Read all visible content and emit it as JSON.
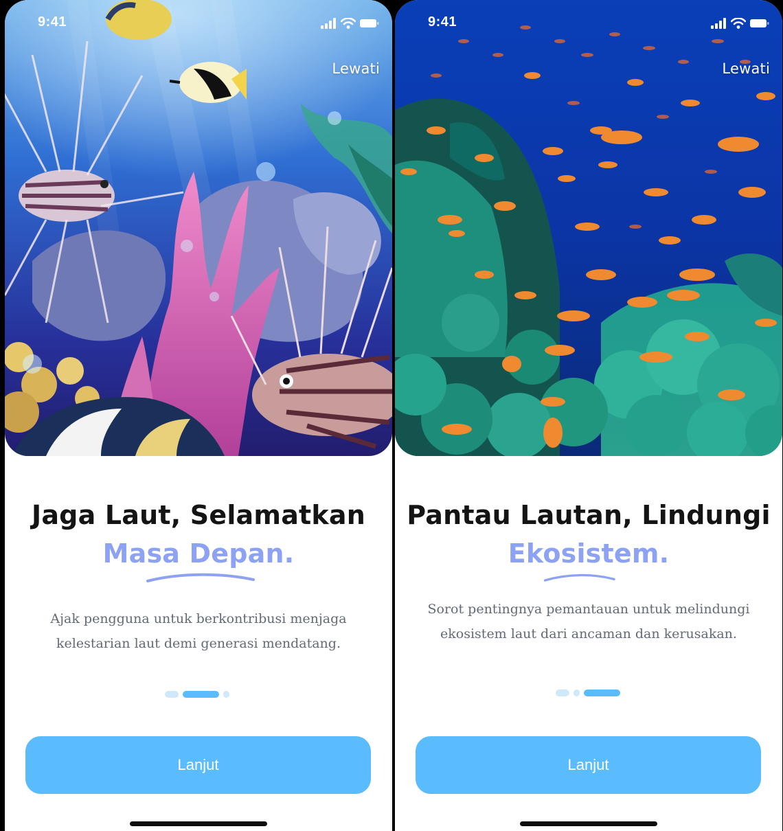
{
  "screens": [
    {
      "status_time": "9:41",
      "skip_label": "Lewati",
      "hero_image": "illustrated-reef-with-lionfish",
      "title_line1": "Jaga Laut, Selamatkan",
      "title_line2": "Masa Depan.",
      "description": "Ajak pengguna untuk berkontribusi menjaga kelestarian laut demi generasi mendatang.",
      "active_page_index": 1,
      "page_count": 3,
      "cta_label": "Lanjut"
    },
    {
      "status_time": "9:41",
      "skip_label": "Lewati",
      "hero_image": "coral-reef-with-orange-anthias",
      "title_line1": "Pantau Lautan, Lindungi",
      "title_line2": "Ekosistem.",
      "description": "Sorot pentingnya pemantauan untuk melindungi ekosistem laut dari ancaman dan kerusakan.",
      "active_page_index": 2,
      "page_count": 3,
      "cta_label": "Lanjut"
    }
  ],
  "colors": {
    "accent_title": "#8ea2f4",
    "button": "#5abcfd",
    "dot_active": "#5abcfd",
    "dot_inactive": "#cfe9fb",
    "title": "#141414",
    "body_text": "#626a76"
  },
  "icons": [
    "signal-icon",
    "wifi-icon",
    "battery-icon"
  ]
}
